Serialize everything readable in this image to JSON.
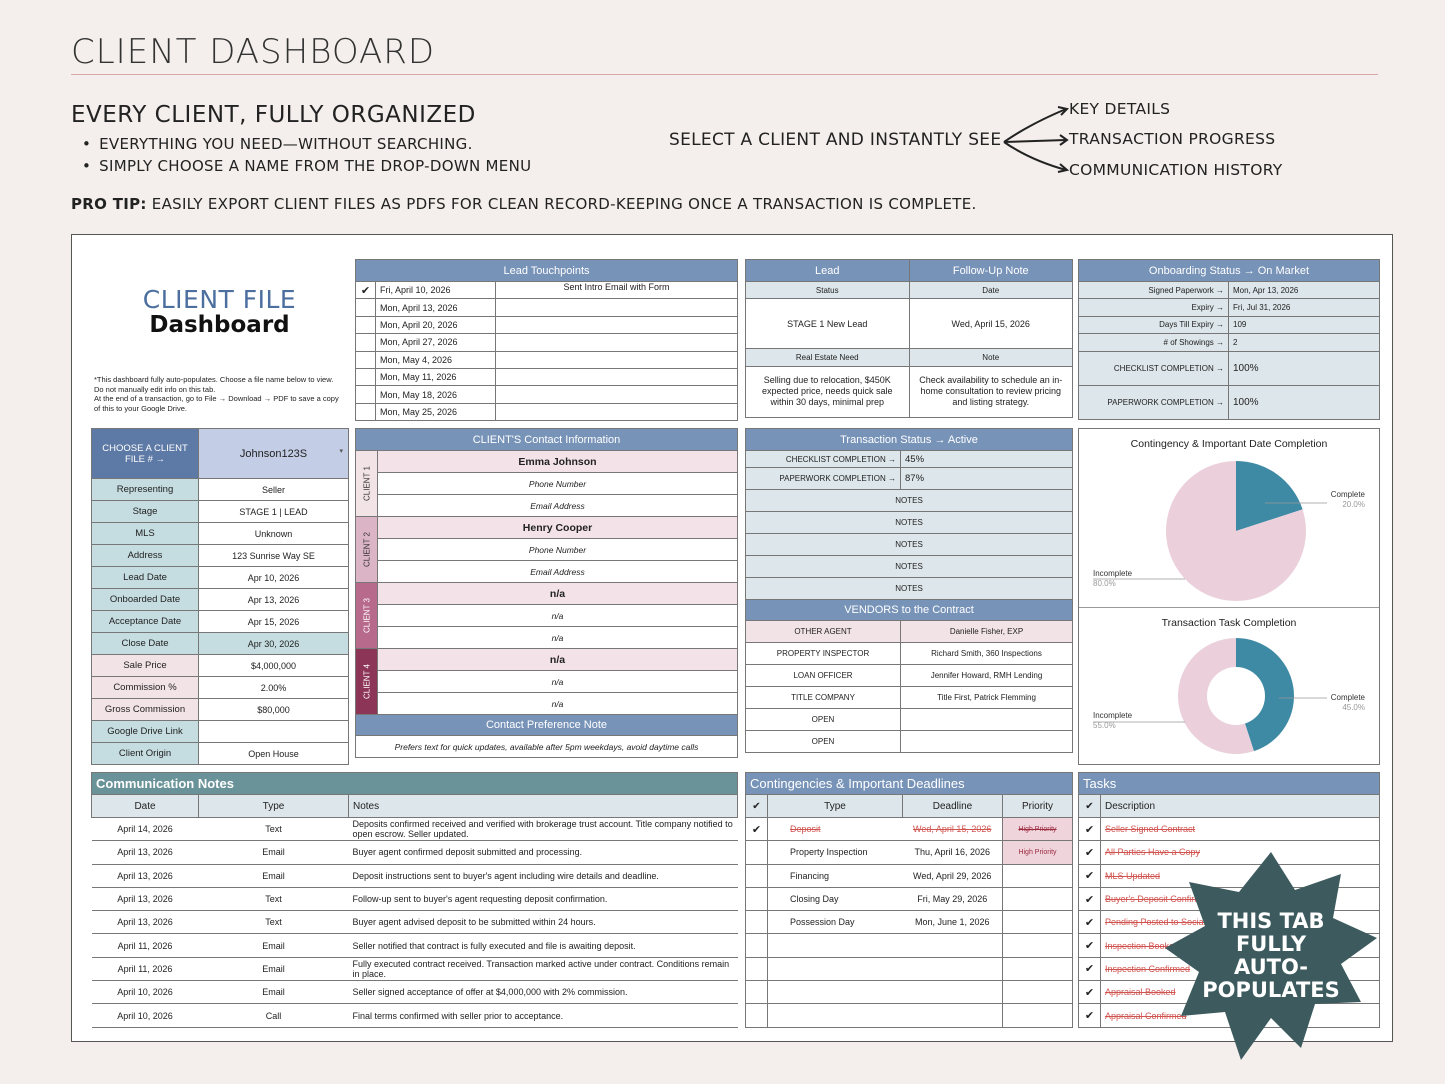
{
  "header": {
    "title": "CLIENT DASHBOARD",
    "subtitle": "EVERY CLIENT, FULLY ORGANIZED",
    "bullets": [
      "EVERYTHING YOU NEED—WITHOUT SEARCHING.",
      "SIMPLY CHOOSE A NAME FROM THE DROP-DOWN MENU"
    ],
    "select_text": "SELECT A CLIENT AND INSTANTLY SEE",
    "key_points": [
      "KEY DETAILS",
      "TRANSACTION PROGRESS",
      "COMMUNICATION HISTORY"
    ],
    "pro_tip_label": "PRO TIP:",
    "pro_tip": " EASILY EXPORT CLIENT FILES AS PDFS FOR CLEAN RECORD-KEEPING ONCE A TRANSACTION IS COMPLETE."
  },
  "logo": {
    "line1": "CLIENT FILE",
    "line2": "Dashboard"
  },
  "note": "*This dashboard fully auto-populates. Choose a file name below to view. Do not manually edit info on this tab.\nAt the end of a transaction, go to File → Download → PDF to save a copy of this to your Google Drive.",
  "touchpoints": {
    "title": "Lead Touchpoints",
    "rows": [
      {
        "check": "✔",
        "date": "Fri, April 10, 2026",
        "note": "Sent Intro Email with Form"
      },
      {
        "check": "",
        "date": "Mon, April 13, 2026",
        "note": ""
      },
      {
        "check": "",
        "date": "Mon, April 20, 2026",
        "note": ""
      },
      {
        "check": "",
        "date": "Mon, April 27, 2026",
        "note": ""
      },
      {
        "check": "",
        "date": "Mon, May 4, 2026",
        "note": ""
      },
      {
        "check": "",
        "date": "Mon, May 11, 2026",
        "note": ""
      },
      {
        "check": "",
        "date": "Mon, May 18, 2026",
        "note": ""
      },
      {
        "check": "",
        "date": "Mon, May 25, 2026",
        "note": ""
      }
    ]
  },
  "lead": {
    "lead_label": "Lead",
    "followup_label": "Follow-Up Note",
    "status_label": "Status",
    "date_label": "Date",
    "status": "STAGE 1 New Lead",
    "date": "Wed, April 15, 2026",
    "need_label": "Real Estate Need",
    "note_label": "Note",
    "need": "Selling due to relocation, $450K expected price, needs quick sale within 30 days, minimal prep",
    "note": "Check availability to schedule an in-home consultation to review pricing and listing strategy."
  },
  "onboarding": {
    "title": "Onboarding Status →  On Market",
    "rows": [
      {
        "label": "Signed Paperwork →",
        "value": "Mon, Apr 13, 2026"
      },
      {
        "label": "Expiry →",
        "value": "Fri, Jul 31, 2026"
      },
      {
        "label": "Days Till Expiry →",
        "value": "109"
      },
      {
        "label": "# of Showings →",
        "value": "2"
      }
    ],
    "checklist_label": "CHECKLIST COMPLETION →",
    "checklist": "100%",
    "paperwork_label": "PAPERWORK COMPLETION →",
    "paperwork": "100%"
  },
  "client_file": {
    "choose_label": "CHOOSE A CLIENT FILE # →",
    "selected": "Johnson123S",
    "rows": [
      {
        "label": "Representing",
        "value": "Seller"
      },
      {
        "label": "Stage",
        "value": "STAGE 1 | LEAD"
      },
      {
        "label": "MLS",
        "value": "Unknown"
      },
      {
        "label": "Address",
        "value": "123 Sunrise Way SE"
      },
      {
        "label": "Lead Date",
        "value": "Apr 10, 2026"
      },
      {
        "label": "Onboarded Date",
        "value": "Apr 13, 2026"
      },
      {
        "label": "Acceptance Date",
        "value": "Apr 15, 2026"
      },
      {
        "label": "Close Date",
        "value": "Apr 30, 2026"
      },
      {
        "label": "Sale Price",
        "value": "$4,000,000"
      },
      {
        "label": "Commission %",
        "value": "2.00%"
      },
      {
        "label": "Gross Commission",
        "value": "$80,000"
      },
      {
        "label": "Google Drive Link",
        "value": ""
      },
      {
        "label": "Client Origin",
        "value": "Open House"
      }
    ]
  },
  "contacts": {
    "title": "CLIENT'S Contact Information",
    "clients": [
      {
        "tag": "CLIENT 1",
        "name": "Emma Johnson",
        "phone": "Phone Number",
        "email": "Email Address"
      },
      {
        "tag": "CLIENT 2",
        "name": "Henry Cooper",
        "phone": "Phone Number",
        "email": "Email Address"
      },
      {
        "tag": "CLIENT 3",
        "name": "n/a",
        "phone": "n/a",
        "email": "n/a"
      },
      {
        "tag": "CLIENT 4",
        "name": "n/a",
        "phone": "n/a",
        "email": "n/a"
      }
    ],
    "pref_title": "Contact Preference Note",
    "pref": "Prefers text for quick updates, available after 5pm weekdays, avoid daytime calls"
  },
  "transaction": {
    "title": "Transaction Status →  Active",
    "checklist_label": "CHECKLIST COMPLETION →",
    "checklist": "45%",
    "paperwork_label": "PAPERWORK COMPLETION →",
    "paperwork": "87%",
    "notes": [
      "NOTES",
      "NOTES",
      "NOTES",
      "NOTES",
      "NOTES"
    ]
  },
  "vendors": {
    "title": "VENDORS to the Contract",
    "rows": [
      {
        "role": "OTHER AGENT",
        "name": "Danielle Fisher, EXP"
      },
      {
        "role": "PROPERTY INSPECTOR",
        "name": "Richard Smith, 360 Inspections"
      },
      {
        "role": "LOAN OFFICER",
        "name": "Jennifer Howard, RMH Lending"
      },
      {
        "role": "TITLE COMPANY",
        "name": "Title First, Patrick Flemming"
      },
      {
        "role": "OPEN",
        "name": ""
      },
      {
        "role": "OPEN",
        "name": ""
      }
    ]
  },
  "charts": {
    "pie": {
      "title": "Contingency & Important Date Completion",
      "complete_label": "Complete",
      "complete_pct": "20.0%",
      "incomplete_label": "Incomplete",
      "incomplete_pct": "80.0%"
    },
    "donut": {
      "title": "Transaction Task Completion",
      "complete_label": "Complete",
      "complete_pct": "45.0%",
      "incomplete_label": "Incomplete",
      "incomplete_pct": "55.0%"
    }
  },
  "chart_data": [
    {
      "type": "pie",
      "title": "Contingency & Important Date Completion",
      "categories": [
        "Complete",
        "Incomplete"
      ],
      "values": [
        20.0,
        80.0
      ],
      "colors": [
        "#3e8aa5",
        "#ebd0dc"
      ]
    },
    {
      "type": "pie",
      "title": "Transaction Task Completion",
      "categories": [
        "Complete",
        "Incomplete"
      ],
      "values": [
        45.0,
        55.0
      ],
      "colors": [
        "#3e8aa5",
        "#ebd0dc"
      ]
    }
  ],
  "comm": {
    "title": "Communication Notes",
    "cols": [
      "Date",
      "Type",
      "Notes"
    ],
    "rows": [
      {
        "date": "April 14, 2026",
        "type": "Text",
        "note": "Deposits confirmed received and verified with brokerage trust account. Title company notified to open escrow. Seller updated."
      },
      {
        "date": "April 13, 2026",
        "type": "Email",
        "note": "Buyer agent confirmed deposit submitted and processing."
      },
      {
        "date": "April 13, 2026",
        "type": "Email",
        "note": "Deposit instructions sent to buyer's agent including wire details and deadline."
      },
      {
        "date": "April 13, 2026",
        "type": "Text",
        "note": "Follow-up sent to buyer's agent requesting deposit confirmation."
      },
      {
        "date": "April 13, 2026",
        "type": "Text",
        "note": "Buyer agent advised deposit to be submitted within 24 hours."
      },
      {
        "date": "April 11, 2026",
        "type": "Email",
        "note": "Seller notified that contract is fully executed and file is awaiting deposit."
      },
      {
        "date": "April 11, 2026",
        "type": "Email",
        "note": "Fully executed contract received. Transaction marked active under contract. Conditions remain in place."
      },
      {
        "date": "April 10, 2026",
        "type": "Email",
        "note": "Seller signed acceptance of offer at $4,000,000 with 2% commission."
      },
      {
        "date": "April 10, 2026",
        "type": "Call",
        "note": "Final terms confirmed with seller prior to acceptance."
      }
    ]
  },
  "deadlines": {
    "title": "Contingencies & Important Deadlines",
    "cols": [
      "✔",
      "Type",
      "Deadline",
      "Priority"
    ],
    "rows": [
      {
        "check": "✔",
        "type": "Deposit",
        "deadline": "Wed, April 15, 2026",
        "priority": "High Priority",
        "done": true
      },
      {
        "check": "",
        "type": "Property Inspection",
        "deadline": "Thu, April 16, 2026",
        "priority": "High Priority",
        "done": false
      },
      {
        "check": "",
        "type": "Financing",
        "deadline": "Wed, April 29, 2026",
        "priority": "",
        "done": false
      },
      {
        "check": "",
        "type": "Closing Day",
        "deadline": "Fri, May 29, 2026",
        "priority": "",
        "done": false
      },
      {
        "check": "",
        "type": "Possession Day",
        "deadline": "Mon, June 1, 2026",
        "priority": "",
        "done": false
      }
    ]
  },
  "tasks": {
    "title": "Tasks",
    "cols": [
      "✔",
      "Description"
    ],
    "rows": [
      {
        "check": "✔",
        "desc": "Seller Signed Contract"
      },
      {
        "check": "✔",
        "desc": "All Parties Have a Copy"
      },
      {
        "check": "✔",
        "desc": "MLS Updated"
      },
      {
        "check": "✔",
        "desc": "Buyer's Deposit Confirmed"
      },
      {
        "check": "✔",
        "desc": "Pending Posted to Social"
      },
      {
        "check": "✔",
        "desc": "Inspection Booked"
      },
      {
        "check": "✔",
        "desc": "Inspection Confirmed"
      },
      {
        "check": "✔",
        "desc": "Appraisal Booked"
      },
      {
        "check": "✔",
        "desc": "Appraisal Confirmed"
      }
    ]
  },
  "badge": {
    "lines": [
      "THIS TAB",
      "FULLY",
      "AUTO-",
      "POPULATES"
    ],
    "color": "#3d5b5e"
  }
}
